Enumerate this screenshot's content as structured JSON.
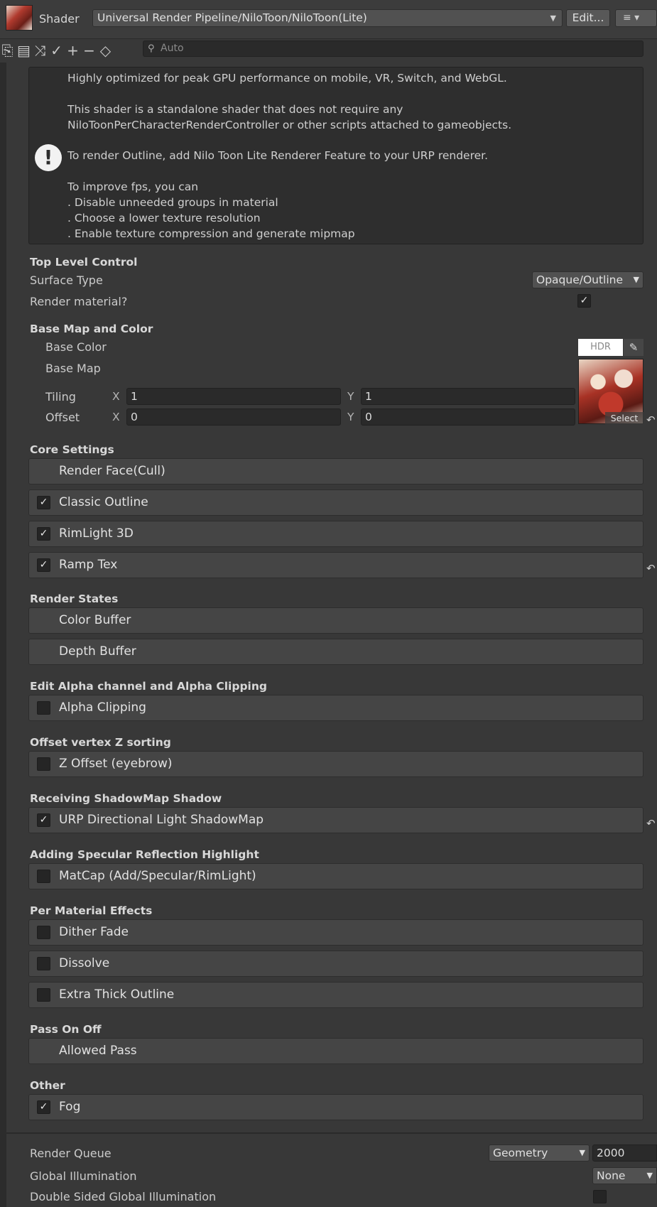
{
  "header": {
    "shader_label": "Shader",
    "shader_value": "Universal Render Pipeline/NiloToon/NiloToon(Lite)",
    "edit_label": "Edit...",
    "list_icon": "≡ ▾"
  },
  "search": {
    "placeholder": "Auto"
  },
  "help": {
    "lines": [
      "Highly optimized for peak GPU performance on mobile, VR, Switch, and WebGL.",
      "This shader is a standalone shader that does not require any",
      "NiloToonPerCharacterRenderController or other scripts attached to gameobjects.",
      "To render Outline, add Nilo Toon Lite Renderer Feature to your URP renderer.",
      "To improve fps, you can",
      ". Disable unneeded groups in material",
      ". Choose a lower texture resolution",
      ". Enable texture compression and generate mipmap"
    ]
  },
  "top_level": {
    "title": "Top Level Control",
    "surface_type_label": "Surface Type",
    "surface_type_value": "Opaque/Outline",
    "render_material_label": "Render material?",
    "render_material_checked": true
  },
  "base_map": {
    "title": "Base Map and Color",
    "base_color_label": "Base Color",
    "hdr_label": "HDR",
    "base_map_label": "Base Map",
    "tiling_label": "Tiling",
    "offset_label": "Offset",
    "x_label": "X",
    "y_label": "Y",
    "tiling_x": "1",
    "tiling_y": "1",
    "offset_x": "0",
    "offset_y": "0",
    "select_label": "Select"
  },
  "sections": [
    {
      "title": "Core Settings"
    },
    {
      "title": "Render States"
    },
    {
      "title": "Edit Alpha channel and Alpha Clipping"
    },
    {
      "title": "Offset vertex Z sorting"
    },
    {
      "title": "Receiving ShadowMap Shadow"
    },
    {
      "title": "Adding Specular Reflection Highlight"
    },
    {
      "title": "Per Material Effects"
    },
    {
      "title": "Pass On Off"
    },
    {
      "title": "Other"
    }
  ],
  "foldouts": [
    {
      "label": "Render Face(Cull)",
      "checkbox": false,
      "checked": false
    },
    {
      "label": "Classic Outline",
      "checkbox": true,
      "checked": true
    },
    {
      "label": "RimLight 3D",
      "checkbox": true,
      "checked": true
    },
    {
      "label": "Ramp Tex",
      "checkbox": true,
      "checked": true
    },
    {
      "label": "Color Buffer",
      "checkbox": false,
      "checked": false
    },
    {
      "label": "Depth Buffer",
      "checkbox": false,
      "checked": false
    },
    {
      "label": "Alpha Clipping",
      "checkbox": true,
      "checked": false
    },
    {
      "label": "Z Offset (eyebrow)",
      "checkbox": true,
      "checked": false
    },
    {
      "label": "URP Directional Light ShadowMap",
      "checkbox": true,
      "checked": true
    },
    {
      "label": "MatCap (Add/Specular/RimLight)",
      "checkbox": true,
      "checked": false
    },
    {
      "label": "Dither Fade",
      "checkbox": true,
      "checked": false
    },
    {
      "label": "Dissolve",
      "checkbox": true,
      "checked": false
    },
    {
      "label": "Extra Thick Outline",
      "checkbox": true,
      "checked": false
    },
    {
      "label": "Allowed Pass",
      "checkbox": false,
      "checked": false
    },
    {
      "label": "Fog",
      "checkbox": true,
      "checked": true
    }
  ],
  "bottom": {
    "render_queue_label": "Render Queue",
    "render_queue_dropdown": "Geometry",
    "render_queue_value": "2000",
    "gi_label": "Global Illumination",
    "gi_value": "None",
    "double_sided_gi_label": "Double Sided Global Illumination",
    "double_sided_gi_checked": false
  },
  "icons": {
    "check": "✓",
    "revert": "↶",
    "dropdown_arrow": "▼"
  }
}
